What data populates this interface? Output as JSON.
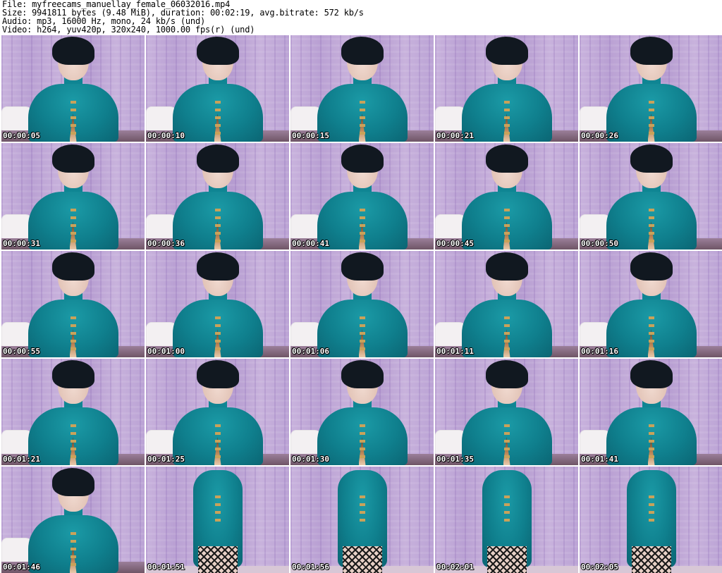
{
  "header": {
    "file": "File: myfreecams_manuellay_female_06032016.mp4",
    "size": "Size: 9941811 bytes (9.48 MiB), duration: 00:02:19, avg.bitrate: 572 kb/s",
    "audio": "Audio: mp3, 16000 Hz, mono, 24 kb/s (und)",
    "video": "Video: h264, yuv420p, 320x240, 1000.00 fps(r) (und)"
  },
  "thumbnails": [
    {
      "timestamp": "00:00:05",
      "kind": "portrait"
    },
    {
      "timestamp": "00:00:10",
      "kind": "portrait"
    },
    {
      "timestamp": "00:00:15",
      "kind": "portrait"
    },
    {
      "timestamp": "00:00:21",
      "kind": "portrait"
    },
    {
      "timestamp": "00:00:26",
      "kind": "portrait"
    },
    {
      "timestamp": "00:00:31",
      "kind": "portrait"
    },
    {
      "timestamp": "00:00:36",
      "kind": "portrait"
    },
    {
      "timestamp": "00:00:41",
      "kind": "portrait"
    },
    {
      "timestamp": "00:00:45",
      "kind": "portrait"
    },
    {
      "timestamp": "00:00:50",
      "kind": "portrait"
    },
    {
      "timestamp": "00:00:55",
      "kind": "portrait"
    },
    {
      "timestamp": "00:01:00",
      "kind": "portrait"
    },
    {
      "timestamp": "00:01:06",
      "kind": "portrait"
    },
    {
      "timestamp": "00:01:11",
      "kind": "portrait"
    },
    {
      "timestamp": "00:01:16",
      "kind": "portrait"
    },
    {
      "timestamp": "00:01:21",
      "kind": "portrait"
    },
    {
      "timestamp": "00:01:25",
      "kind": "portrait"
    },
    {
      "timestamp": "00:01:30",
      "kind": "portrait"
    },
    {
      "timestamp": "00:01:35",
      "kind": "portrait"
    },
    {
      "timestamp": "00:01:41",
      "kind": "portrait"
    },
    {
      "timestamp": "00:01:46",
      "kind": "portrait"
    },
    {
      "timestamp": "00:01:51",
      "kind": "body"
    },
    {
      "timestamp": "00:01:56",
      "kind": "body"
    },
    {
      "timestamp": "00:02:01",
      "kind": "body"
    },
    {
      "timestamp": "00:02:05",
      "kind": "body"
    }
  ]
}
